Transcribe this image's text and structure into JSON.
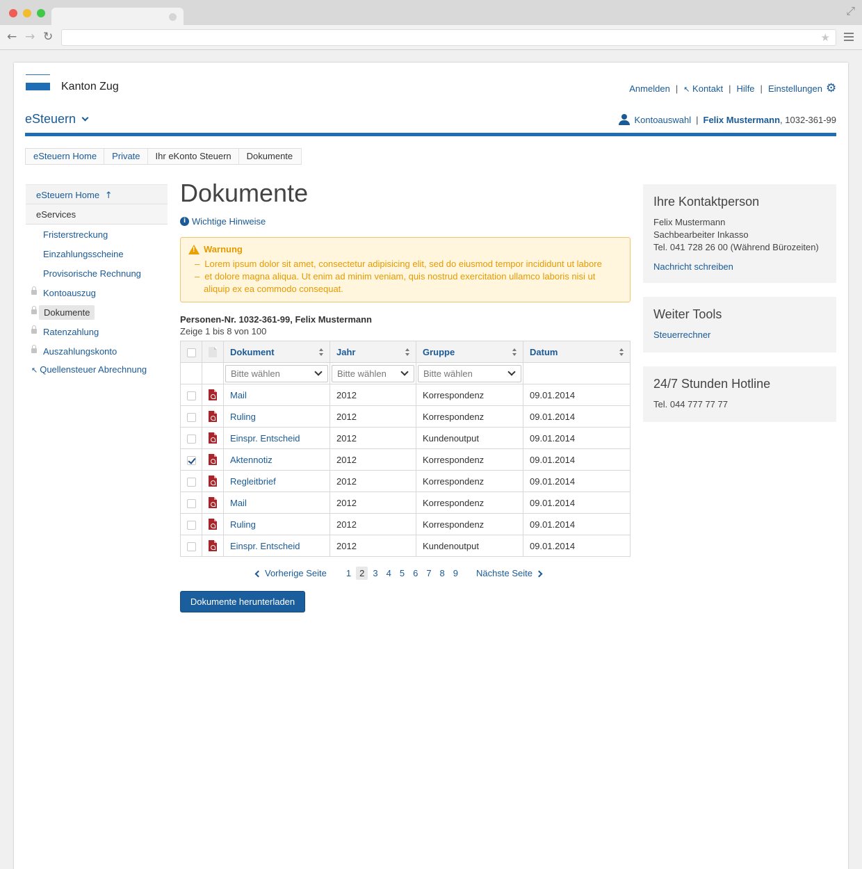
{
  "brand": {
    "name": "Kanton Zug",
    "app": "eSteuern",
    "accent": "#1f6db5"
  },
  "topnav": {
    "login": "Anmelden",
    "contact": "Kontakt",
    "help": "Hilfe",
    "settings": "Einstellungen"
  },
  "account": {
    "label": "Kontoauswahl",
    "user": "Felix Mustermann",
    "number": ", 1032-361-99"
  },
  "breadcrumb": [
    "eSteuern Home",
    "Private",
    "Ihr eKonto Steuern",
    "Dokumente"
  ],
  "sidebar": {
    "home": "eSteuern Home",
    "section": "eServices",
    "items": [
      {
        "label": "Fristerstreckung"
      },
      {
        "label": "Einzahlungsscheine"
      },
      {
        "label": "Provisorische Rechnung"
      },
      {
        "label": "Kontoauszug"
      },
      {
        "label": "Dokumente"
      },
      {
        "label": "Ratenzahlung"
      },
      {
        "label": "Auszahlungskonto"
      },
      {
        "label": "Quellensteuer Abrechnung"
      }
    ]
  },
  "main": {
    "title": "Dokumente",
    "hint": "Wichtige Hinweise",
    "warning": {
      "title": "Warnung",
      "lines": [
        "Lorem ipsum dolor sit amet, consectetur adipisicing elit, sed do eiusmod tempor incididunt ut labore",
        "et dolore magna aliqua. Ut enim ad minim veniam, quis nostrud exercitation ullamco laboris nisi ut aliquip ex ea commodo consequat."
      ]
    },
    "person": "Personen-Nr. 1032-361-99, Felix Mustermann",
    "showing": "Zeige 1 bis 8 von 100"
  },
  "table": {
    "headers": [
      "Dokument",
      "Jahr",
      "Gruppe",
      "Datum"
    ],
    "filter_placeholder": "Bitte wählen",
    "rows": [
      {
        "doc": "Mail",
        "year": "2012",
        "group": "Korrespondenz",
        "date": "09.01.2014",
        "checked": false
      },
      {
        "doc": "Ruling",
        "year": "2012",
        "group": "Korrespondenz",
        "date": "09.01.2014",
        "checked": false
      },
      {
        "doc": "Einspr. Entscheid",
        "year": "2012",
        "group": "Kundenoutput",
        "date": "09.01.2014",
        "checked": false
      },
      {
        "doc": "Aktennotiz",
        "year": "2012",
        "group": "Korrespondenz",
        "date": "09.01.2014",
        "checked": true
      },
      {
        "doc": "Regleitbrief",
        "year": "2012",
        "group": "Korrespondenz",
        "date": "09.01.2014",
        "checked": false
      },
      {
        "doc": "Mail",
        "year": "2012",
        "group": "Korrespondenz",
        "date": "09.01.2014",
        "checked": false
      },
      {
        "doc": "Ruling",
        "year": "2012",
        "group": "Korrespondenz",
        "date": "09.01.2014",
        "checked": false
      },
      {
        "doc": "Einspr. Entscheid",
        "year": "2012",
        "group": "Kundenoutput",
        "date": "09.01.2014",
        "checked": false
      }
    ]
  },
  "pagination": {
    "prev": "Vorherige Seite",
    "next": "Nächste Seite",
    "pages": [
      "1",
      "2",
      "3",
      "4",
      "5",
      "6",
      "7",
      "8",
      "9"
    ],
    "current": "2"
  },
  "download_button": "Dokumente herunterladen",
  "contact_box": {
    "title": "Ihre Kontaktperson",
    "name": "Felix Mustermann",
    "role": "Sachbearbeiter Inkasso",
    "phone": "Tel. 041 728 26 00 (Während Bürozeiten)",
    "link": "Nachricht schreiben"
  },
  "tools_box": {
    "title": "Weiter Tools",
    "link": "Steuerrechner"
  },
  "hotline_box": {
    "title": "24/7 Stunden Hotline",
    "phone": "Tel. 044 777 77 77"
  }
}
